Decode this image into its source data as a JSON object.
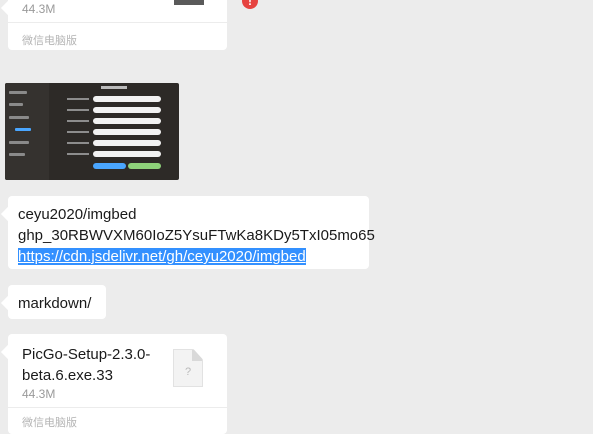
{
  "top_file_card": {
    "file_size": "44.3M",
    "source": "微信电脑版"
  },
  "image_message": {
    "alt": "PicGo 图床设置截图"
  },
  "text_message": {
    "line1": "ceyu2020/imgbed",
    "line2": "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",
    "link": "https://cdn.jsdelivr.net/gh/ceyu2020/imgbed"
  },
  "markdown_message": {
    "text": "markdown/"
  },
  "bottom_file_card": {
    "file_name": "PicGo-Setup-2.3.0-beta.6.exe.33",
    "file_size": "44.3M",
    "source": "微信电脑版",
    "icon_glyph": "?"
  },
  "colors": {
    "background": "#ececec",
    "bubble": "#ffffff",
    "link_highlight": "#3390ff",
    "error_badge": "#e64340"
  }
}
